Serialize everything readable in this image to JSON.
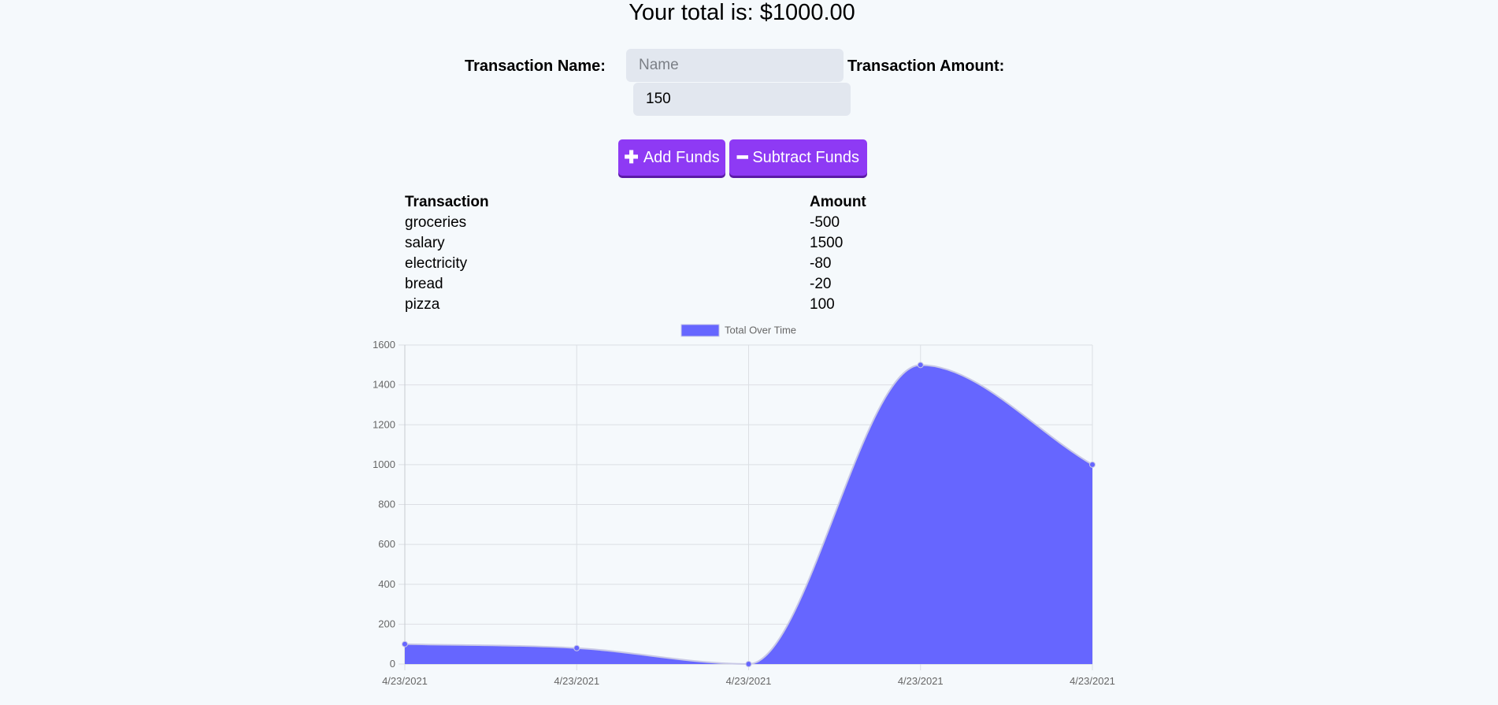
{
  "header": {
    "total_text": "Your total is: $1000.00"
  },
  "form": {
    "name_label": "Transaction Name:",
    "name_placeholder": "Name",
    "name_value": "",
    "amount_label": "Transaction Amount:",
    "amount_value": "150",
    "add_button": {
      "label": "Add Funds",
      "icon": "plus-icon"
    },
    "subtract_button": {
      "label": "Subtract Funds",
      "icon": "minus-icon"
    }
  },
  "table": {
    "headers": [
      "Transaction",
      "Amount"
    ],
    "rows": [
      [
        "groceries",
        "-500"
      ],
      [
        "salary",
        "1500"
      ],
      [
        "electricity",
        "-80"
      ],
      [
        "bread",
        "-20"
      ],
      [
        "pizza",
        "100"
      ]
    ]
  },
  "colors": {
    "page_background": "#f5f9fc",
    "button": "#8e3af4",
    "chart_fill": "#6666ff"
  },
  "chart_data": {
    "type": "area",
    "x": [
      "4/23/2021",
      "4/23/2021",
      "4/23/2021",
      "4/23/2021",
      "4/23/2021"
    ],
    "series": [
      {
        "name": "Total Over Time",
        "values": [
          100,
          80,
          0,
          1500,
          1000
        ],
        "color": "#6666ff"
      }
    ],
    "ylim": [
      0,
      1600
    ],
    "yticks": [
      0,
      200,
      400,
      600,
      800,
      1000,
      1200,
      1400,
      1600
    ],
    "grid": true,
    "legend": "top-center",
    "smooth": true
  }
}
